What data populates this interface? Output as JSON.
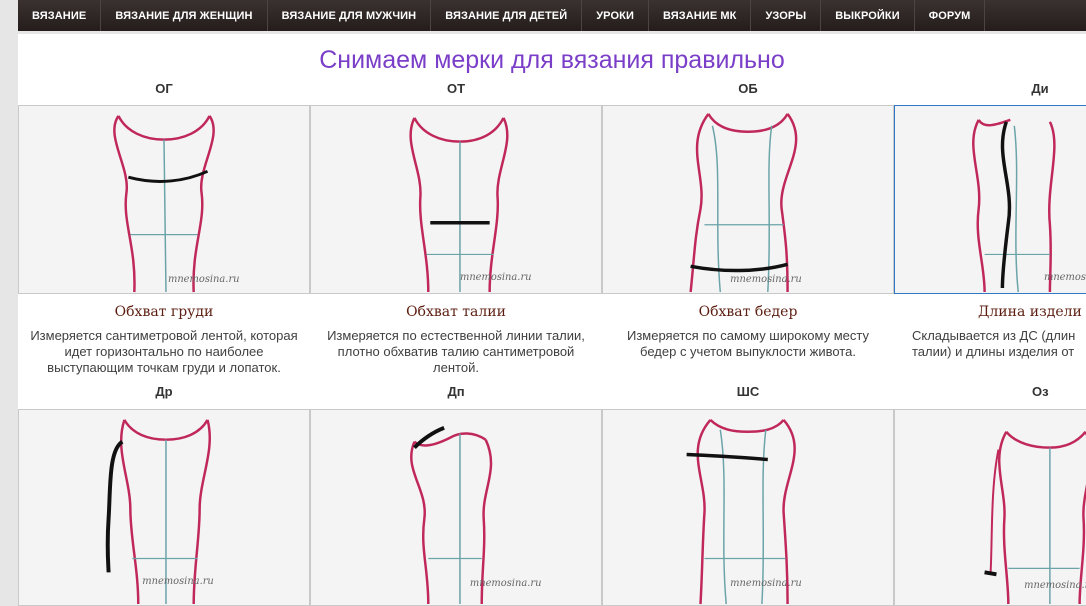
{
  "nav": {
    "items": [
      "ВЯЗАНИЕ",
      "ВЯЗАНИЕ ДЛЯ ЖЕНЩИН",
      "ВЯЗАНИЕ ДЛЯ МУЖЧИН",
      "ВЯЗАНИЕ ДЛЯ ДЕТЕЙ",
      "УРОКИ",
      "ВЯЗАНИЕ МК",
      "УЗОРЫ",
      "ВЫКРОЙКИ",
      "ФОРУМ"
    ]
  },
  "page": {
    "title": "Снимаем мерки для вязания правильно"
  },
  "watermark": "mnemosina.ru",
  "colors": {
    "accent_title": "#7a3ec8",
    "body_outline": "#c0285a",
    "guide_line": "#6aa3a8",
    "measure_line": "#111111",
    "active_border": "#2f77c8"
  },
  "row1": [
    {
      "code": "ОГ",
      "title": "Обхват груди",
      "desc": [
        "Измеряется сантиметровой лентой, которая",
        "идет горизонтально по наиболее",
        "выступающим точкам груди и лопаток."
      ]
    },
    {
      "code": "ОТ",
      "title": "Обхват талии",
      "desc": [
        "Измеряется по естественной линии талии,",
        "плотно обхватив талию сантиметровой",
        "лентой."
      ]
    },
    {
      "code": "ОБ",
      "title": "Обхват бедер",
      "desc": [
        "Измеряется по самому широкому месту",
        "бедер с учетом выпуклости живота."
      ]
    },
    {
      "code": "Ди",
      "title": "Длина издели",
      "desc": [
        "Складывается из ДС (длин",
        "талии) и длины изделия от"
      ]
    }
  ],
  "row2": [
    {
      "code": "Др"
    },
    {
      "code": "Дп"
    },
    {
      "code": "ШС"
    },
    {
      "code": "Оз"
    }
  ]
}
